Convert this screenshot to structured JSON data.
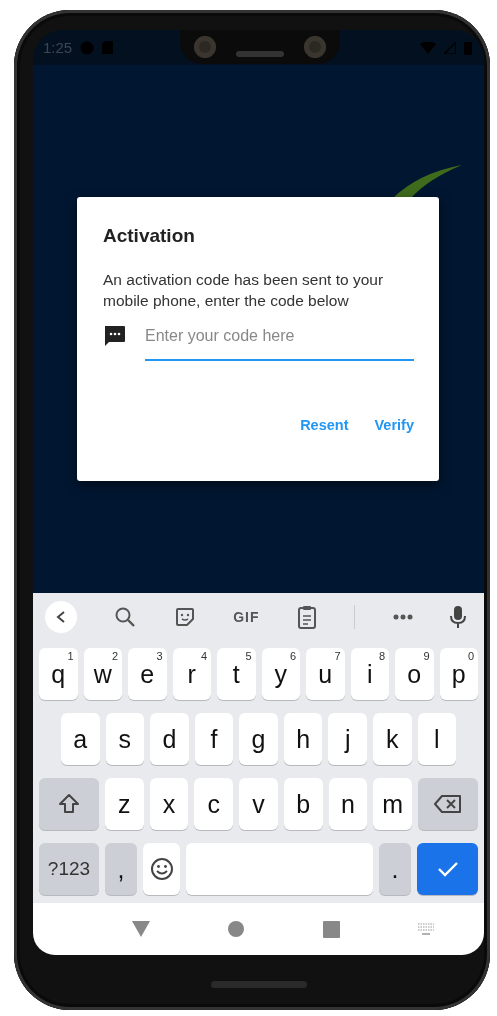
{
  "status_bar": {
    "time": "1:25"
  },
  "dialog": {
    "title": "Activation",
    "message": "An activation code has been sent to your mobile phone, enter the code below",
    "field": {
      "placeholder": "Enter your code here",
      "focused": true
    },
    "buttons": [
      "Resent",
      "Verify"
    ]
  },
  "keyboard": {
    "toolbar": {
      "gif": "GIF"
    },
    "rows": [
      {
        "keys": [
          {
            "kind": "letter",
            "label": "q",
            "hint": "1"
          },
          {
            "kind": "letter",
            "label": "w",
            "hint": "2"
          },
          {
            "kind": "letter",
            "label": "e",
            "hint": "3"
          },
          {
            "kind": "letter",
            "label": "r",
            "hint": "4"
          },
          {
            "kind": "letter",
            "label": "t",
            "hint": "5"
          },
          {
            "kind": "letter",
            "label": "y",
            "hint": "6"
          },
          {
            "kind": "letter",
            "label": "u",
            "hint": "7"
          },
          {
            "kind": "letter",
            "label": "i",
            "hint": "8"
          },
          {
            "kind": "letter",
            "label": "o",
            "hint": "9"
          },
          {
            "kind": "letter",
            "label": "p",
            "hint": "0"
          }
        ]
      },
      {
        "keys": [
          {
            "kind": "letter",
            "label": "a"
          },
          {
            "kind": "letter",
            "label": "s"
          },
          {
            "kind": "letter",
            "label": "d"
          },
          {
            "kind": "letter",
            "label": "f"
          },
          {
            "kind": "letter",
            "label": "g"
          },
          {
            "kind": "letter",
            "label": "h"
          },
          {
            "kind": "letter",
            "label": "j"
          },
          {
            "kind": "letter",
            "label": "k"
          },
          {
            "kind": "letter",
            "label": "l"
          }
        ]
      },
      {
        "keys": [
          {
            "kind": "shift"
          },
          {
            "kind": "letter",
            "label": "z"
          },
          {
            "kind": "letter",
            "label": "x"
          },
          {
            "kind": "letter",
            "label": "c"
          },
          {
            "kind": "letter",
            "label": "v"
          },
          {
            "kind": "letter",
            "label": "b"
          },
          {
            "kind": "letter",
            "label": "n"
          },
          {
            "kind": "letter",
            "label": "m"
          },
          {
            "kind": "backspace"
          }
        ]
      },
      {
        "keys": [
          {
            "kind": "symbols",
            "label": "?123"
          },
          {
            "kind": "punct",
            "label": ","
          },
          {
            "kind": "emoji"
          },
          {
            "kind": "space"
          },
          {
            "kind": "punct",
            "label": "."
          },
          {
            "kind": "enter"
          }
        ]
      }
    ]
  }
}
